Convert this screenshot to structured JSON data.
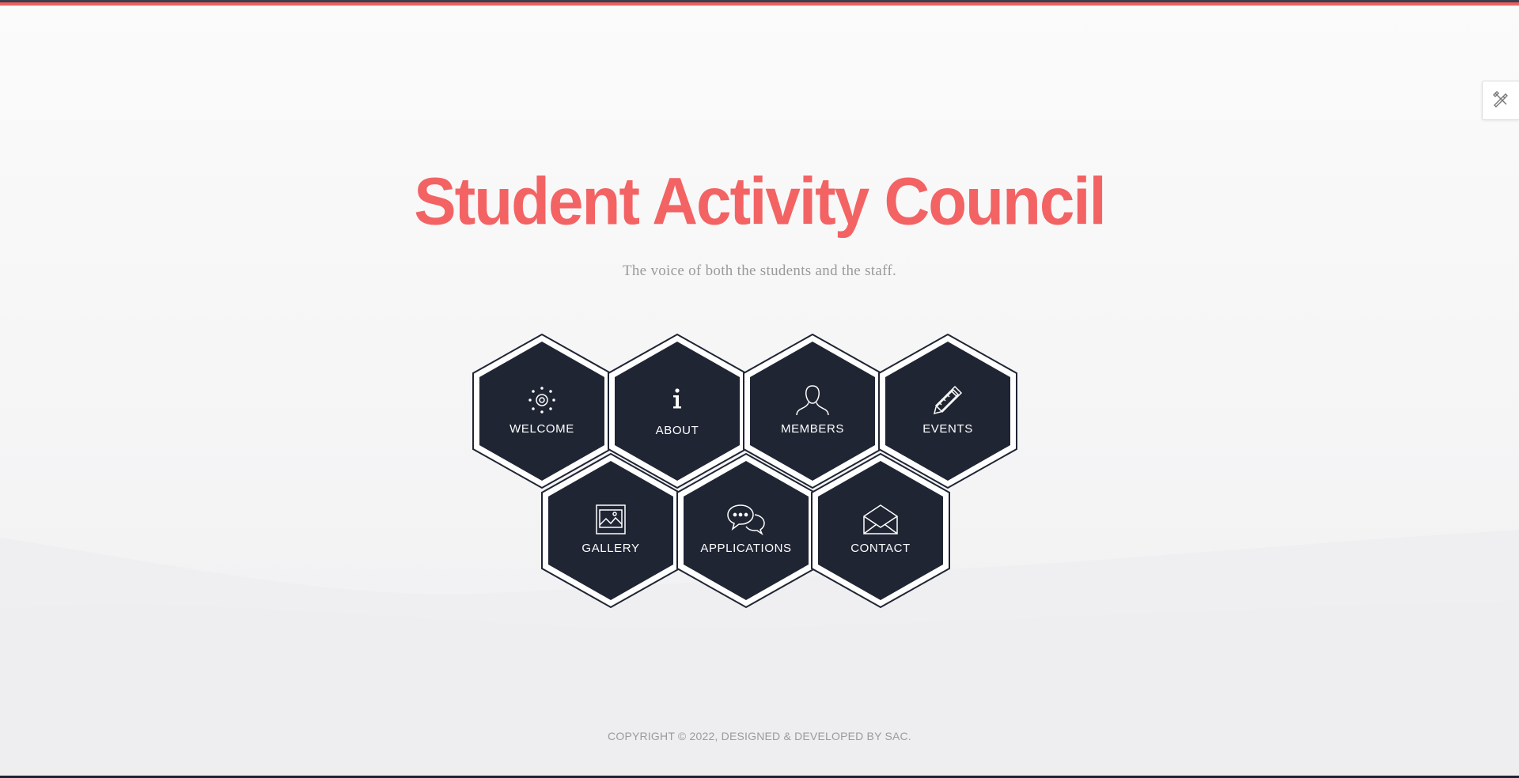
{
  "header": {
    "title": "Student Activity Council",
    "subtitle": "The voice of both the students and the staff."
  },
  "tools": {
    "customize_icon": "tools-icon"
  },
  "nav": {
    "items": [
      {
        "label": "WELCOME",
        "icon": "sun-icon"
      },
      {
        "label": "ABOUT",
        "icon": "info-icon"
      },
      {
        "label": "MEMBERS",
        "icon": "user-icon"
      },
      {
        "label": "EVENTS",
        "icon": "pencil-ruler-icon"
      },
      {
        "label": "GALLERY",
        "icon": "image-icon"
      },
      {
        "label": "APPLICATIONS",
        "icon": "chat-icon"
      },
      {
        "label": "CONTACT",
        "icon": "envelope-icon"
      }
    ]
  },
  "footer": {
    "text": "COPYRIGHT © 2022, DESIGNED & DEVELOPED BY SAC."
  },
  "colors": {
    "accent": "#f36364",
    "hex_fill": "#1f2533",
    "text_muted": "#9b9b9b",
    "top_bar": "#3a3f4e"
  }
}
